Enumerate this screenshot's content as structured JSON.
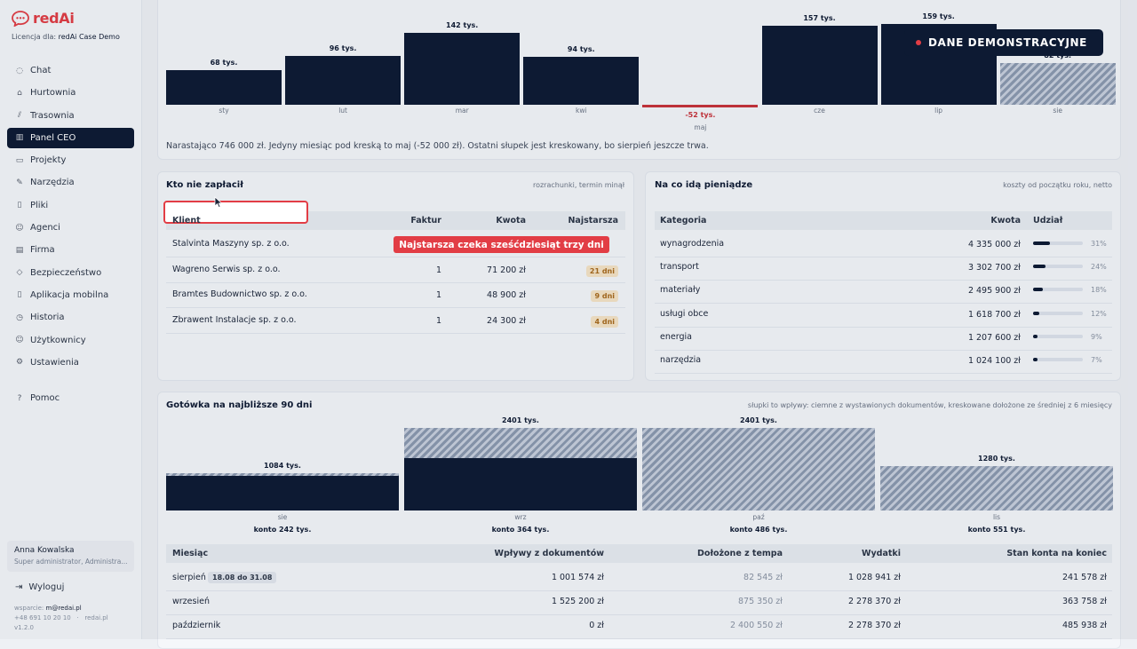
{
  "brand": {
    "name": "redAi",
    "license_prefix": "Licencja dla:",
    "license_name": "redAi Case Demo"
  },
  "nav": [
    {
      "label": "Chat",
      "icon": "chat-icon",
      "glyph": "◌"
    },
    {
      "label": "Hurtownia",
      "icon": "warehouse-icon",
      "glyph": "⌂"
    },
    {
      "label": "Trasownia",
      "icon": "route-icon",
      "glyph": "⫽"
    },
    {
      "label": "Panel CEO",
      "icon": "chart-icon",
      "glyph": "▥",
      "active": true
    },
    {
      "label": "Projekty",
      "icon": "folder-icon",
      "glyph": "▭"
    },
    {
      "label": "Narzędzia",
      "icon": "wrench-icon",
      "glyph": "✎"
    },
    {
      "label": "Pliki",
      "icon": "file-icon",
      "glyph": "▯"
    },
    {
      "label": "Agenci",
      "icon": "user-icon",
      "glyph": "☺"
    },
    {
      "label": "Firma",
      "icon": "building-icon",
      "glyph": "▤"
    },
    {
      "label": "Bezpieczeństwo",
      "icon": "shield-icon",
      "glyph": "◇"
    },
    {
      "label": "Aplikacja mobilna",
      "icon": "phone-icon",
      "glyph": "▯"
    },
    {
      "label": "Historia",
      "icon": "clock-icon",
      "glyph": "◷"
    },
    {
      "label": "Użytkownicy",
      "icon": "users-icon",
      "glyph": "☺"
    },
    {
      "label": "Ustawienia",
      "icon": "gear-icon",
      "glyph": "⚙"
    }
  ],
  "help": {
    "label": "Pomoc",
    "icon": "help-icon",
    "glyph": "?"
  },
  "user": {
    "name": "Anna Kowalska",
    "role": "Super administrator, Administra..."
  },
  "logout": {
    "label": "Wyloguj",
    "glyph": "⇥"
  },
  "support": {
    "prefix": "wsparcie:",
    "email": "m@redai.pl",
    "phone": "+48 691 10 20 10",
    "site": "redai.pl",
    "version": "v1.2.0"
  },
  "demo_badge": "DANE DEMONSTRACYJNE",
  "monthly": {
    "summary": "Narastająco 746 000 zł. Jedyny miesiąc pod kreską to maj (-52 000 zł). Ostatni słupek jest kreskowany, bo sierpień jeszcze trwa.",
    "chart_data": {
      "type": "bar",
      "categories": [
        "sty",
        "lut",
        "mar",
        "kwi",
        "maj",
        "cze",
        "lip",
        "sie"
      ],
      "values": [
        68,
        96,
        142,
        94,
        -52,
        157,
        159,
        82
      ],
      "labels": [
        "68 tys.",
        "96 tys.",
        "142 tys.",
        "94 tys.",
        "-52 tys.",
        "157 tys.",
        "159 tys.",
        "82 tys."
      ],
      "partial": [
        false,
        false,
        false,
        false,
        false,
        false,
        false,
        true
      ]
    }
  },
  "receivables": {
    "title": "Kto nie zapłacił",
    "note": "rozrachunki, termin minął",
    "headers": {
      "client": "Klient",
      "invoices": "Faktur",
      "amount": "Kwota",
      "oldest": "Najstarsza"
    },
    "rows": [
      {
        "client": "Stalvinta Maszyny sp. z o.o.",
        "invoices": "",
        "amount": "",
        "days": ""
      },
      {
        "client": "Wagreno Serwis sp. z o.o.",
        "invoices": "1",
        "amount": "71 200 zł",
        "days": "21 dni"
      },
      {
        "client": "Bramtes Budownictwo sp. z o.o.",
        "invoices": "1",
        "amount": "48 900 zł",
        "days": "9 dni"
      },
      {
        "client": "Zbrawent Instalacje sp. z o.o.",
        "invoices": "1",
        "amount": "24 300 zł",
        "days": "4 dni"
      }
    ],
    "callout": "Najstarsza czeka sześćdziesiąt trzy dni"
  },
  "costs": {
    "title": "Na co idą pieniądze",
    "note": "koszty od początku roku, netto",
    "headers": {
      "category": "Kategoria",
      "amount": "Kwota",
      "share": "Udział"
    },
    "rows": [
      {
        "category": "wynagrodzenia",
        "amount": "4 335 000 zł",
        "share": 0.31,
        "pct": "31%"
      },
      {
        "category": "transport",
        "amount": "3 302 700 zł",
        "share": 0.24,
        "pct": "24%"
      },
      {
        "category": "materiały",
        "amount": "2 495 900 zł",
        "share": 0.18,
        "pct": "18%"
      },
      {
        "category": "usługi obce",
        "amount": "1 618 700 zł",
        "share": 0.12,
        "pct": "12%"
      },
      {
        "category": "energia",
        "amount": "1 207 600 zł",
        "share": 0.09,
        "pct": "9%"
      },
      {
        "category": "narzędzia",
        "amount": "1 024 100 zł",
        "share": 0.07,
        "pct": "7%"
      }
    ]
  },
  "cash": {
    "title": "Gotówka na najbliższe 90 dni",
    "note": "słupki to wpływy: ciemne z wystawionych dokumentów, kreskowane dołożone ze średniej z 6 miesięcy",
    "chart_data": {
      "type": "bar",
      "categories": [
        "sie",
        "wrz",
        "paź",
        "lis"
      ],
      "series": [
        {
          "name": "z wystawionych dokumentów",
          "values": [
            1001,
            1525,
            0,
            0
          ]
        },
        {
          "name": "dołożone ze średniej z 6 miesięcy",
          "values": [
            83,
            876,
            2401,
            1280
          ]
        }
      ],
      "totals": [
        "1084 tys.",
        "2401 tys.",
        "2401 tys.",
        "1280 tys."
      ],
      "balances": [
        "konto 242 tys.",
        "konto 364 tys.",
        "konto 486 tys.",
        "konto 551 tys."
      ]
    },
    "headers": {
      "month": "Miesiąc",
      "docs": "Wpływy z dokumentów",
      "tempo": "Dołożone z tempa",
      "expenses": "Wydatki",
      "balance": "Stan konta na koniec"
    },
    "rows": [
      {
        "month": "sierpień",
        "tag": "18.08 do 31.08",
        "docs": "1 001 574 zł",
        "tempo": "82 545 zł",
        "expenses": "1 028 941 zł",
        "balance": "241 578 zł"
      },
      {
        "month": "wrzesień",
        "tag": "",
        "docs": "1 525 200 zł",
        "tempo": "875 350 zł",
        "expenses": "2 278 370 zł",
        "balance": "363 758 zł"
      },
      {
        "month": "październik",
        "tag": "",
        "docs": "0 zł",
        "tempo": "2 400 550 zł",
        "expenses": "2 278 370 zł",
        "balance": "485 938 zł"
      }
    ]
  }
}
